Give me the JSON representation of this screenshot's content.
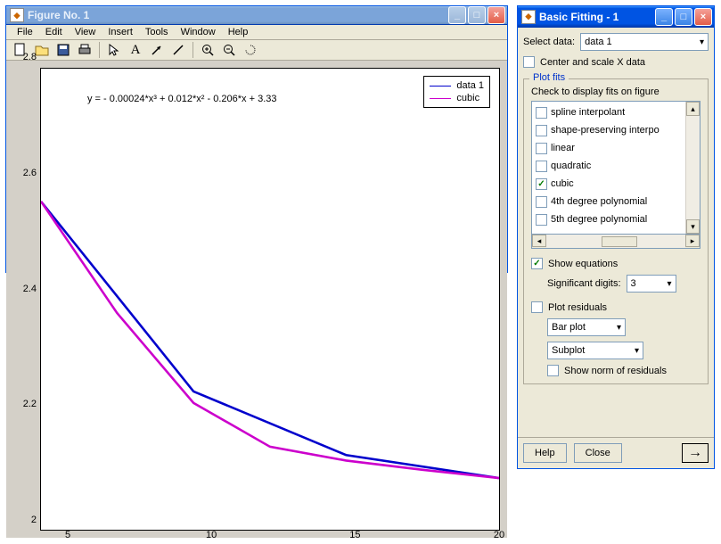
{
  "figure_window": {
    "title": "Figure No. 1",
    "menu": [
      "File",
      "Edit",
      "View",
      "Insert",
      "Tools",
      "Window",
      "Help"
    ],
    "toolbar_icons": [
      "new",
      "open",
      "save",
      "print",
      "pointer",
      "text",
      "arrow",
      "line",
      "zoom-in",
      "zoom-out",
      "rotate"
    ]
  },
  "plot": {
    "equation": "y = - 0.00024*x³ + 0.012*x² - 0.206*x + 3.33",
    "legend": {
      "series1": {
        "label": "data 1",
        "color": "#0000cc"
      },
      "series2": {
        "label": "cubic",
        "color": "#cc00cc"
      }
    },
    "xticks": [
      "5",
      "10",
      "15",
      "20"
    ],
    "yticks": [
      "2",
      "2.2",
      "2.4",
      "2.6",
      "2.8"
    ]
  },
  "chart_data": {
    "type": "line",
    "title": "",
    "xlabel": "",
    "ylabel": "",
    "xlim": [
      5,
      20
    ],
    "ylim": [
      2,
      2.8
    ],
    "x": [
      5,
      10,
      15,
      20
    ],
    "series": [
      {
        "name": "data 1",
        "color": "#0000cc",
        "values": [
          2.57,
          2.24,
          2.13,
          2.09
        ]
      },
      {
        "name": "cubic",
        "color": "#cc00cc",
        "values": [
          2.57,
          2.22,
          2.12,
          2.09
        ]
      }
    ],
    "equation": "y = - 0.00024*x^3 + 0.012*x^2 - 0.206*x + 3.33"
  },
  "fitting_window": {
    "title": "Basic Fitting - 1",
    "select_data_label": "Select data:",
    "select_data_value": "data 1",
    "center_scale_label": "Center and scale X data",
    "plot_fits_title": "Plot fits",
    "plot_fits_hint": "Check to display fits on figure",
    "fits": [
      {
        "label": "spline interpolant",
        "checked": false
      },
      {
        "label": "shape-preserving interpo",
        "checked": false
      },
      {
        "label": "linear",
        "checked": false
      },
      {
        "label": "quadratic",
        "checked": false
      },
      {
        "label": "cubic",
        "checked": true
      },
      {
        "label": "4th degree polynomial",
        "checked": false
      },
      {
        "label": "5th degree polynomial",
        "checked": false
      }
    ],
    "show_equations_label": "Show equations",
    "show_equations_checked": true,
    "sig_digits_label": "Significant digits:",
    "sig_digits_value": "3",
    "plot_residuals_label": "Plot residuals",
    "plot_residuals_checked": false,
    "residual_type_value": "Bar plot",
    "residual_loc_value": "Subplot",
    "show_norm_label": "Show norm of residuals",
    "show_norm_checked": false,
    "help_label": "Help",
    "close_label": "Close"
  }
}
